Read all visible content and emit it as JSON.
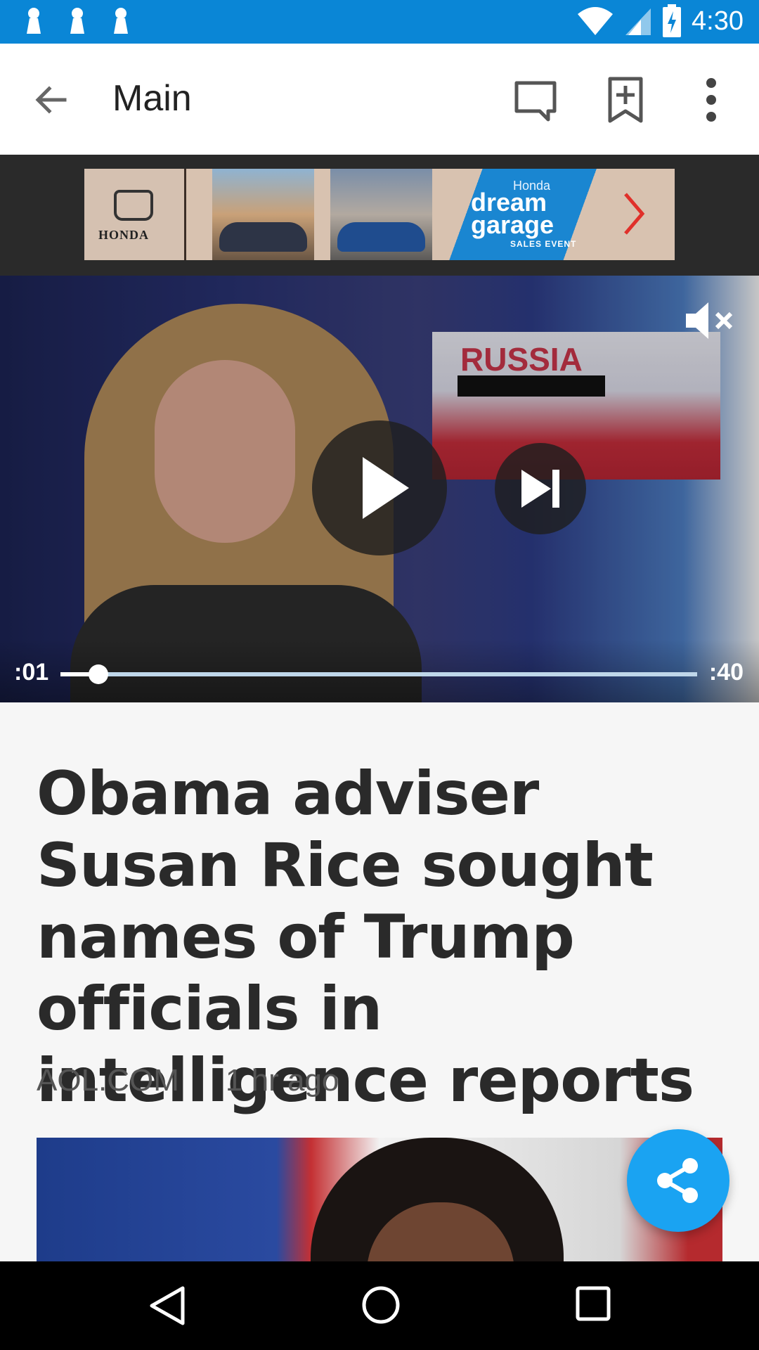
{
  "status_bar": {
    "time": "4:30",
    "icons": [
      "notification-icon",
      "notification-icon",
      "notification-icon",
      "wifi-icon",
      "cell-signal-icon",
      "battery-charging-icon"
    ]
  },
  "app_bar": {
    "title": "Main",
    "icons": [
      "back-arrow-icon",
      "comment-icon",
      "bookmark-add-icon",
      "more-vert-icon"
    ]
  },
  "ad": {
    "brand": "HONDA",
    "headline_small": "Honda",
    "headline_big_1": "dream",
    "headline_big_2": "garage",
    "event": "SALES EVENT"
  },
  "video": {
    "overlay_title": "RUSSIA",
    "time_current": ":01",
    "time_total": ":40",
    "progress": 0.06,
    "muted": true
  },
  "article": {
    "headline": "Obama adviser Susan Rice sought names of Trump officials in intelligence reports",
    "source": "AOL.COM",
    "time_ago": "1 hr ago"
  },
  "colors": {
    "status_bar": "#0a86d6",
    "fab": "#1aa3f2",
    "headline": "#2a2a2a"
  }
}
